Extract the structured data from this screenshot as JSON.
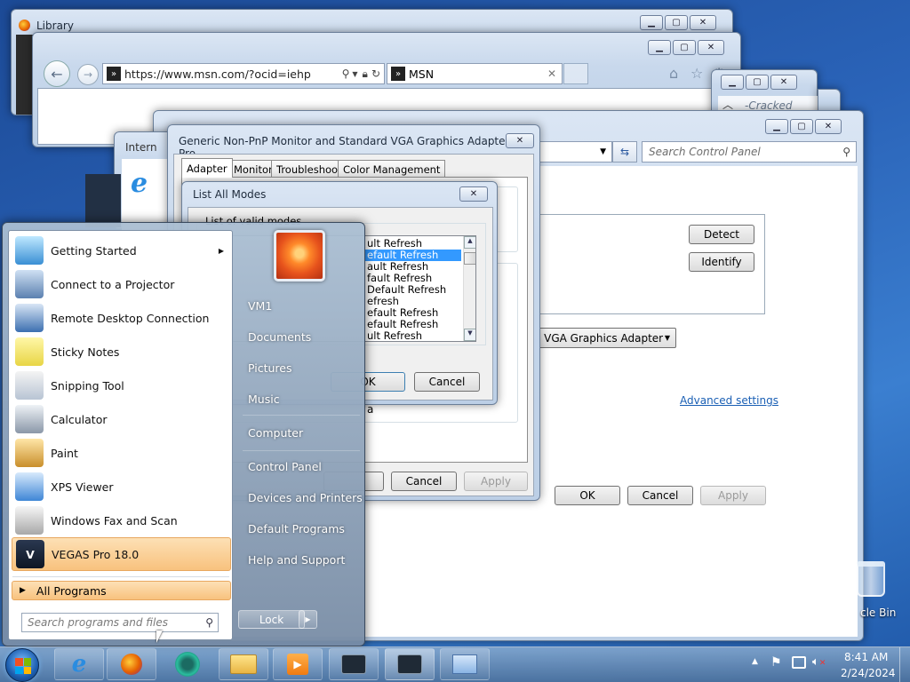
{
  "library": {
    "title": "Library"
  },
  "browser": {
    "address": "https://www.msn.com/?ocid=iehp",
    "tab_title": "MSN",
    "partial_title": "Intern",
    "cracked_text": "-Cracked"
  },
  "control_panel": {
    "search_placeholder": "Search Control Panel",
    "detect_label": "Detect",
    "identify_label": "Identify",
    "adapter_select": "rd VGA Graphics Adapter",
    "advanced_link": "Advanced settings",
    "ok_label": "OK",
    "cancel_label": "Cancel",
    "apply_label": "Apply"
  },
  "adapter_dialog": {
    "title": "Generic Non-PnP Monitor and Standard VGA Graphics Adapter Pro...",
    "tabs": [
      "Adapter",
      "Monitor",
      "Troubleshoot",
      "Color Management"
    ],
    "partial_text": "a",
    "cancel_label": "Cancel",
    "apply_label": "Apply"
  },
  "modes_dialog": {
    "title": "List All Modes",
    "list_label": "List of valid modes",
    "modes": [
      "ult Refresh",
      "efault Refresh",
      "ault Refresh",
      "fault Refresh",
      "Default Refresh",
      "efresh",
      "efault Refresh",
      "efault Refresh",
      "ult Refresh"
    ],
    "selected_index": 1,
    "ok_label": "OK",
    "cancel_label": "Cancel"
  },
  "start_menu": {
    "programs": [
      {
        "label": "Getting Started",
        "icon": "getting-started-icon",
        "has_submenu": true
      },
      {
        "label": "Connect to a Projector",
        "icon": "projector-icon"
      },
      {
        "label": "Remote Desktop Connection",
        "icon": "remote-desktop-icon"
      },
      {
        "label": "Sticky Notes",
        "icon": "sticky-notes-icon"
      },
      {
        "label": "Snipping Tool",
        "icon": "snipping-tool-icon"
      },
      {
        "label": "Calculator",
        "icon": "calculator-icon"
      },
      {
        "label": "Paint",
        "icon": "paint-icon"
      },
      {
        "label": "XPS Viewer",
        "icon": "xps-viewer-icon"
      },
      {
        "label": "Windows Fax and Scan",
        "icon": "fax-scan-icon"
      },
      {
        "label": "VEGAS Pro 18.0",
        "icon": "vegas-pro-icon",
        "highlighted": true
      }
    ],
    "all_programs": "All Programs",
    "search_placeholder": "Search programs and files",
    "right_items": [
      "VM1",
      "Documents",
      "Pictures",
      "Music",
      "Computer",
      "Control Panel",
      "Devices and Printers",
      "Default Programs",
      "Help and Support"
    ],
    "lock_label": "Lock"
  },
  "desktop": {
    "recycle_bin": "cle Bin"
  },
  "taskbar": {
    "time": "8:41 AM",
    "date": "2/24/2024",
    "apps": [
      "internet-explorer-icon",
      "firefox-icon",
      "app-icon",
      "file-explorer-icon",
      "media-player-icon",
      "terminal-icon",
      "terminal-icon",
      "control-panel-icon"
    ]
  },
  "colors": {
    "accent": "#3399ff",
    "highlight": "#fbcf8f",
    "link": "#1a5fb4"
  }
}
